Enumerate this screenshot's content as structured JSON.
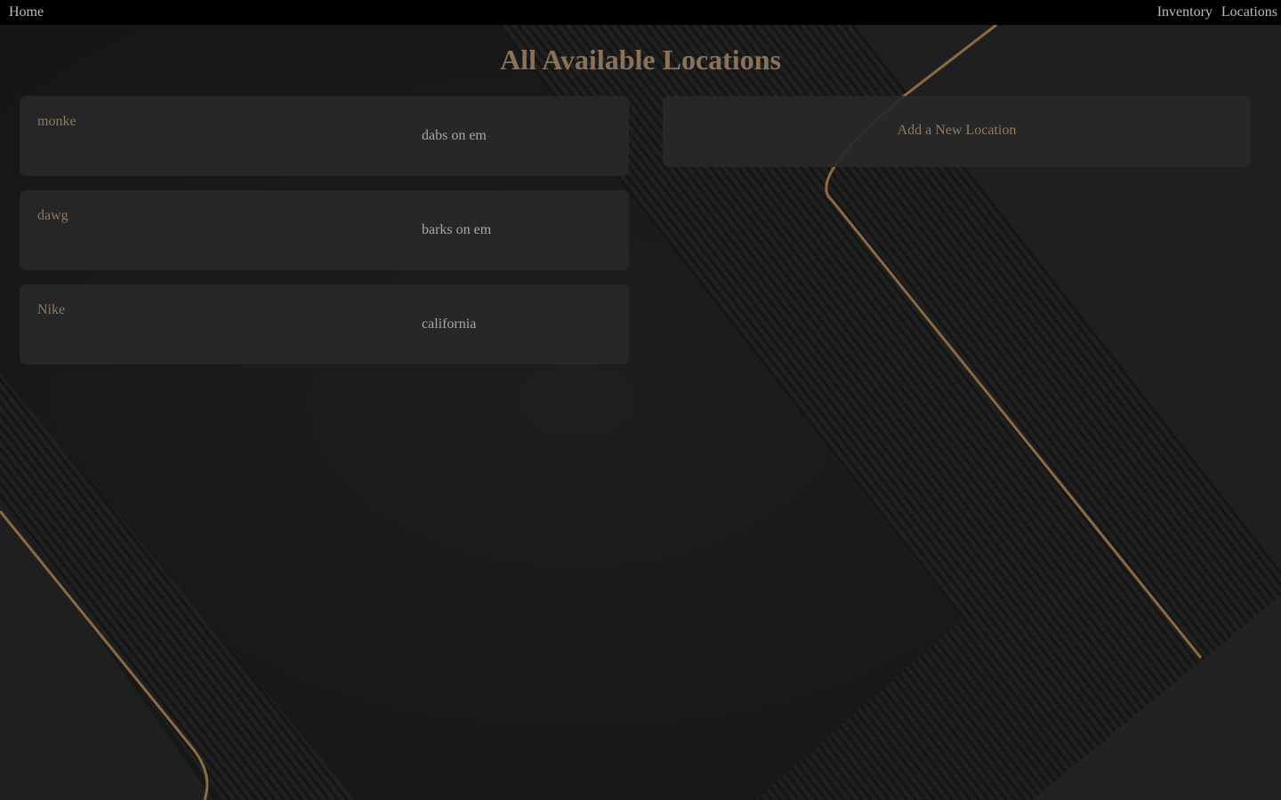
{
  "nav": {
    "home_label": "Home",
    "inventory_label": "Inventory",
    "locations_label": "Locations"
  },
  "page": {
    "title": "All Available Locations"
  },
  "locations": [
    {
      "name": "monke",
      "description": "dabs on em"
    },
    {
      "name": "dawg",
      "description": "barks on em"
    },
    {
      "name": "Nike",
      "description": "california"
    }
  ],
  "add_location": {
    "label": "Add a New Location"
  },
  "colors": {
    "background": "#1c1c1c",
    "navbar": "#000000",
    "accent_gold": "#8a7258",
    "card": "#282828"
  }
}
